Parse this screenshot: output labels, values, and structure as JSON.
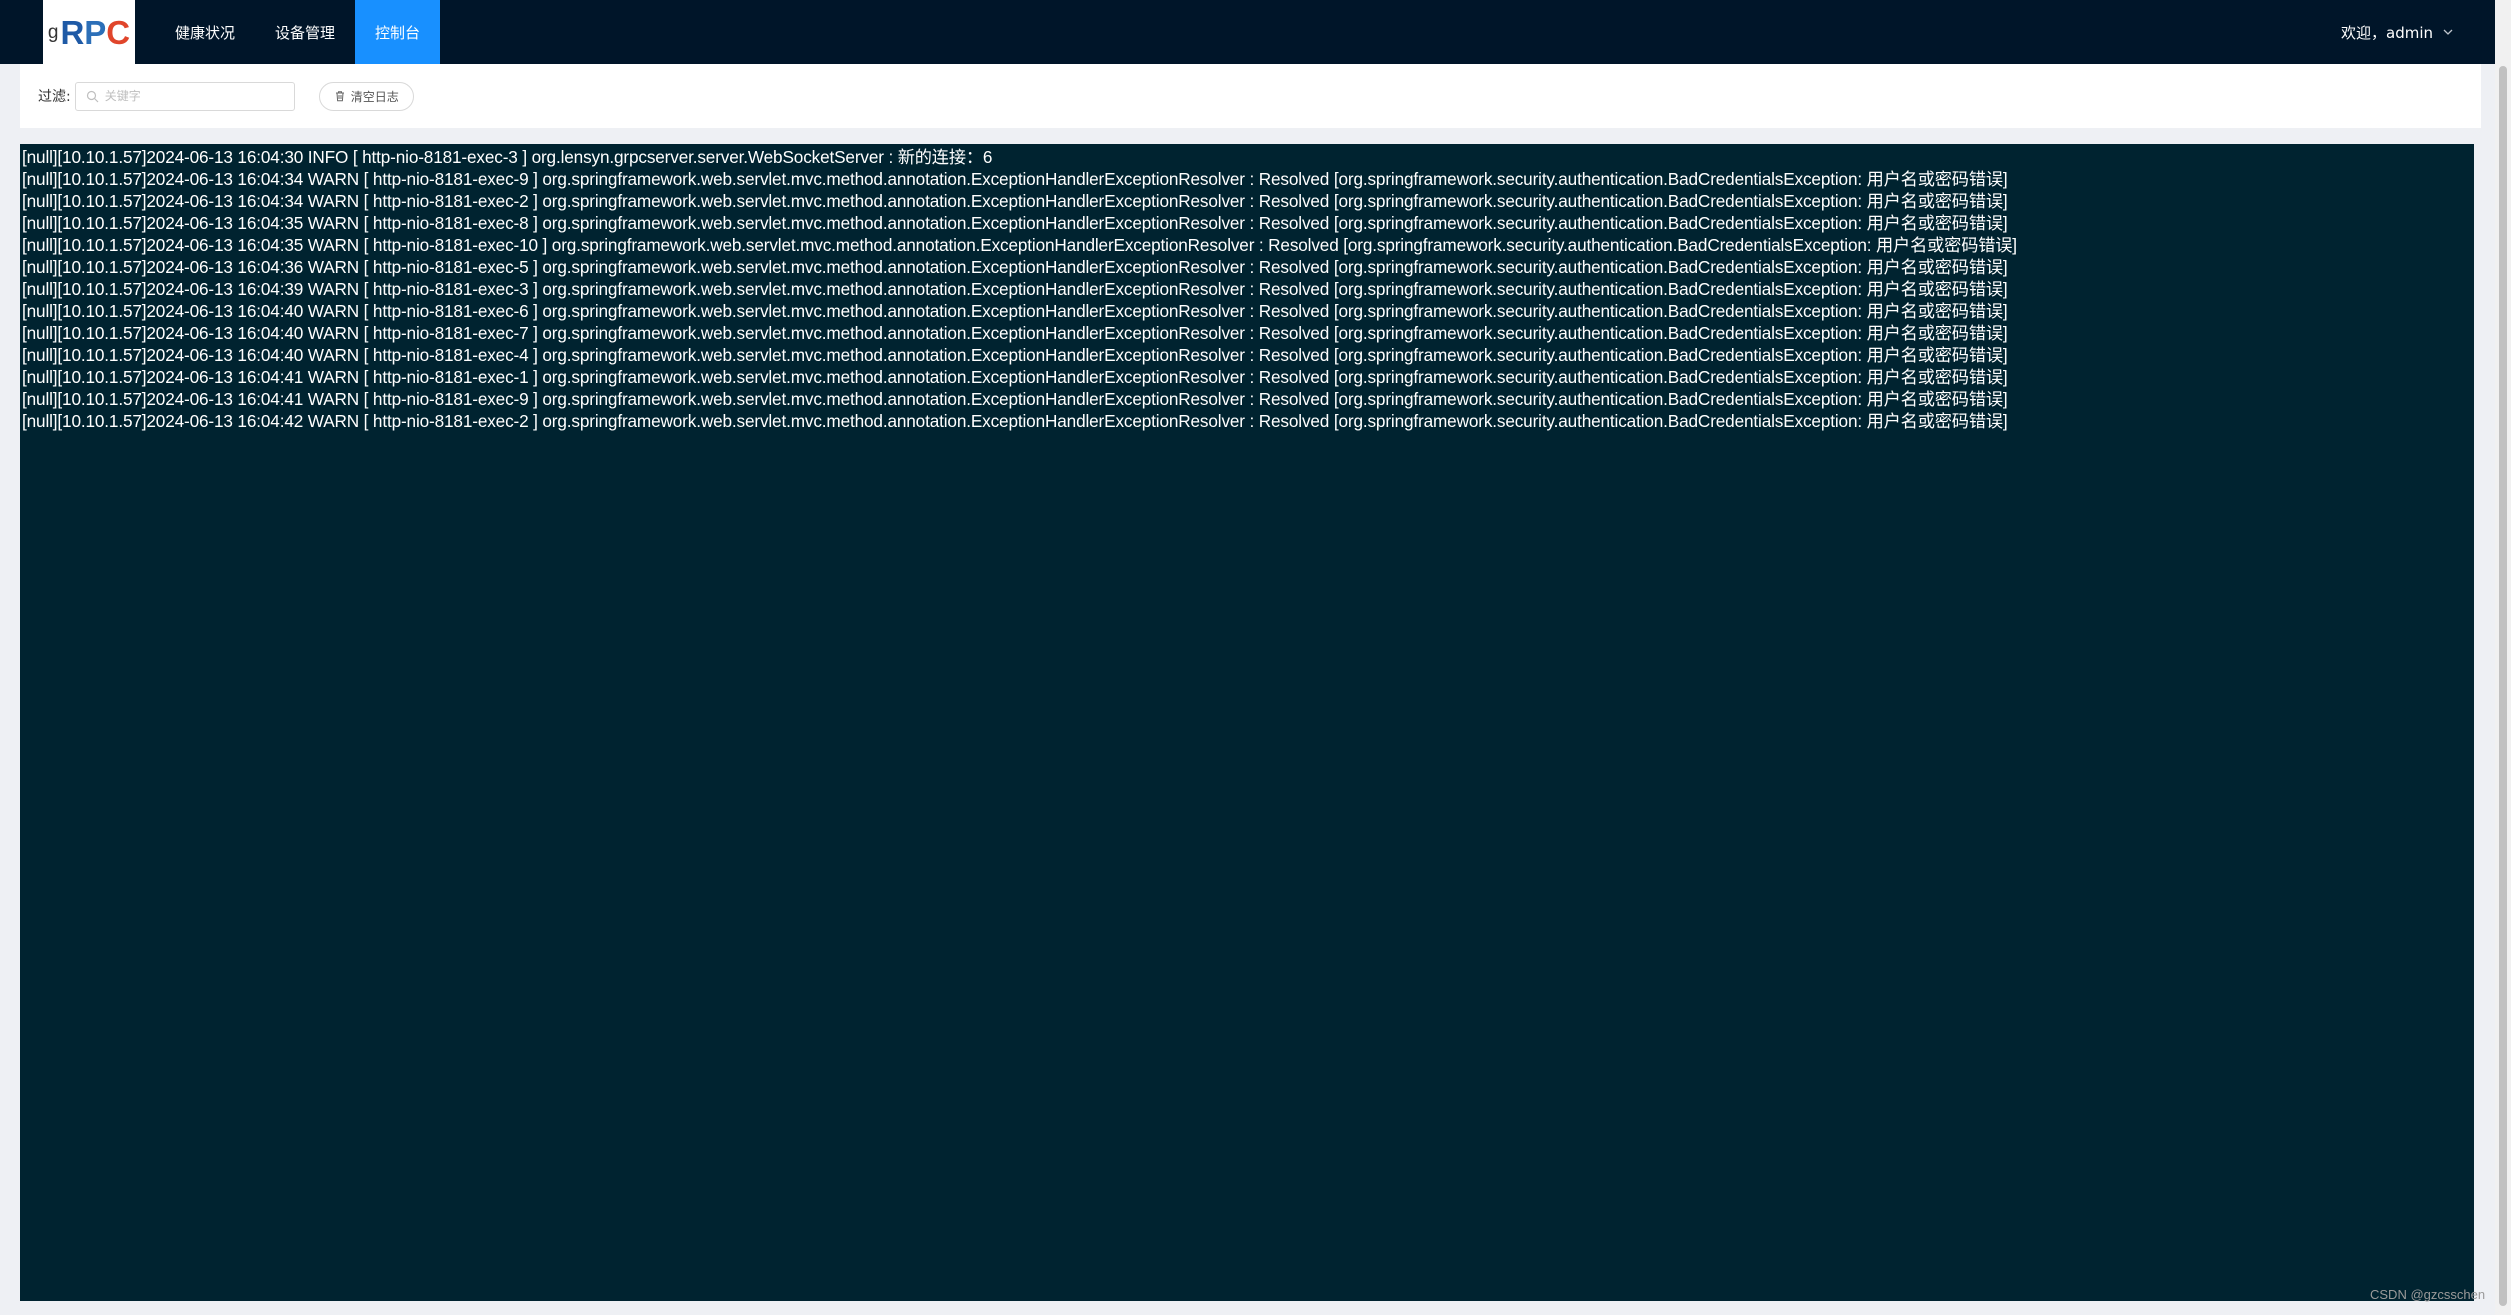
{
  "logo": {
    "g": "g",
    "r": "R",
    "p": "P",
    "c": "C"
  },
  "nav": {
    "items": [
      {
        "label": "健康状况"
      },
      {
        "label": "设备管理"
      },
      {
        "label": "控制台"
      }
    ],
    "active_item": "控制台"
  },
  "user": {
    "greeting": "欢迎，admin"
  },
  "filter": {
    "label": "过滤:",
    "placeholder": "关键字",
    "value": "",
    "clear_button": "清空日志"
  },
  "console": {
    "lines": [
      "[null][10.10.1.57]2024-06-13 16:04:30 INFO [ http-nio-8181-exec-3 ] org.lensyn.grpcserver.server.WebSocketServer : 新的连接：6",
      "[null][10.10.1.57]2024-06-13 16:04:34 WARN [ http-nio-8181-exec-9 ] org.springframework.web.servlet.mvc.method.annotation.ExceptionHandlerExceptionResolver : Resolved [org.springframework.security.authentication.BadCredentialsException: 用户名或密码错误]",
      "[null][10.10.1.57]2024-06-13 16:04:34 WARN [ http-nio-8181-exec-2 ] org.springframework.web.servlet.mvc.method.annotation.ExceptionHandlerExceptionResolver : Resolved [org.springframework.security.authentication.BadCredentialsException: 用户名或密码错误]",
      "[null][10.10.1.57]2024-06-13 16:04:35 WARN [ http-nio-8181-exec-8 ] org.springframework.web.servlet.mvc.method.annotation.ExceptionHandlerExceptionResolver : Resolved [org.springframework.security.authentication.BadCredentialsException: 用户名或密码错误]",
      "[null][10.10.1.57]2024-06-13 16:04:35 WARN [ http-nio-8181-exec-10 ] org.springframework.web.servlet.mvc.method.annotation.ExceptionHandlerExceptionResolver : Resolved [org.springframework.security.authentication.BadCredentialsException: 用户名或密码错误]",
      "[null][10.10.1.57]2024-06-13 16:04:36 WARN [ http-nio-8181-exec-5 ] org.springframework.web.servlet.mvc.method.annotation.ExceptionHandlerExceptionResolver : Resolved [org.springframework.security.authentication.BadCredentialsException: 用户名或密码错误]",
      "[null][10.10.1.57]2024-06-13 16:04:39 WARN [ http-nio-8181-exec-3 ] org.springframework.web.servlet.mvc.method.annotation.ExceptionHandlerExceptionResolver : Resolved [org.springframework.security.authentication.BadCredentialsException: 用户名或密码错误]",
      "[null][10.10.1.57]2024-06-13 16:04:40 WARN [ http-nio-8181-exec-6 ] org.springframework.web.servlet.mvc.method.annotation.ExceptionHandlerExceptionResolver : Resolved [org.springframework.security.authentication.BadCredentialsException: 用户名或密码错误]",
      "[null][10.10.1.57]2024-06-13 16:04:40 WARN [ http-nio-8181-exec-7 ] org.springframework.web.servlet.mvc.method.annotation.ExceptionHandlerExceptionResolver : Resolved [org.springframework.security.authentication.BadCredentialsException: 用户名或密码错误]",
      "[null][10.10.1.57]2024-06-13 16:04:40 WARN [ http-nio-8181-exec-4 ] org.springframework.web.servlet.mvc.method.annotation.ExceptionHandlerExceptionResolver : Resolved [org.springframework.security.authentication.BadCredentialsException: 用户名或密码错误]",
      "[null][10.10.1.57]2024-06-13 16:04:41 WARN [ http-nio-8181-exec-1 ] org.springframework.web.servlet.mvc.method.annotation.ExceptionHandlerExceptionResolver : Resolved [org.springframework.security.authentication.BadCredentialsException: 用户名或密码错误]",
      "[null][10.10.1.57]2024-06-13 16:04:41 WARN [ http-nio-8181-exec-9 ] org.springframework.web.servlet.mvc.method.annotation.ExceptionHandlerExceptionResolver : Resolved [org.springframework.security.authentication.BadCredentialsException: 用户名或密码错误]",
      "[null][10.10.1.57]2024-06-13 16:04:42 WARN [ http-nio-8181-exec-2 ] org.springframework.web.servlet.mvc.method.annotation.ExceptionHandlerExceptionResolver : Resolved [org.springframework.security.authentication.BadCredentialsException: 用户名或密码错误]"
    ]
  },
  "watermark": "CSDN @gzcsschen",
  "colors": {
    "nav_bg": "#001529",
    "nav_active": "#1890ff",
    "console_bg": "#002330",
    "console_text": "#ffffff"
  },
  "icons": {
    "search": "search-icon",
    "clear": "trash-icon",
    "user_menu": "chevron-down-icon"
  }
}
